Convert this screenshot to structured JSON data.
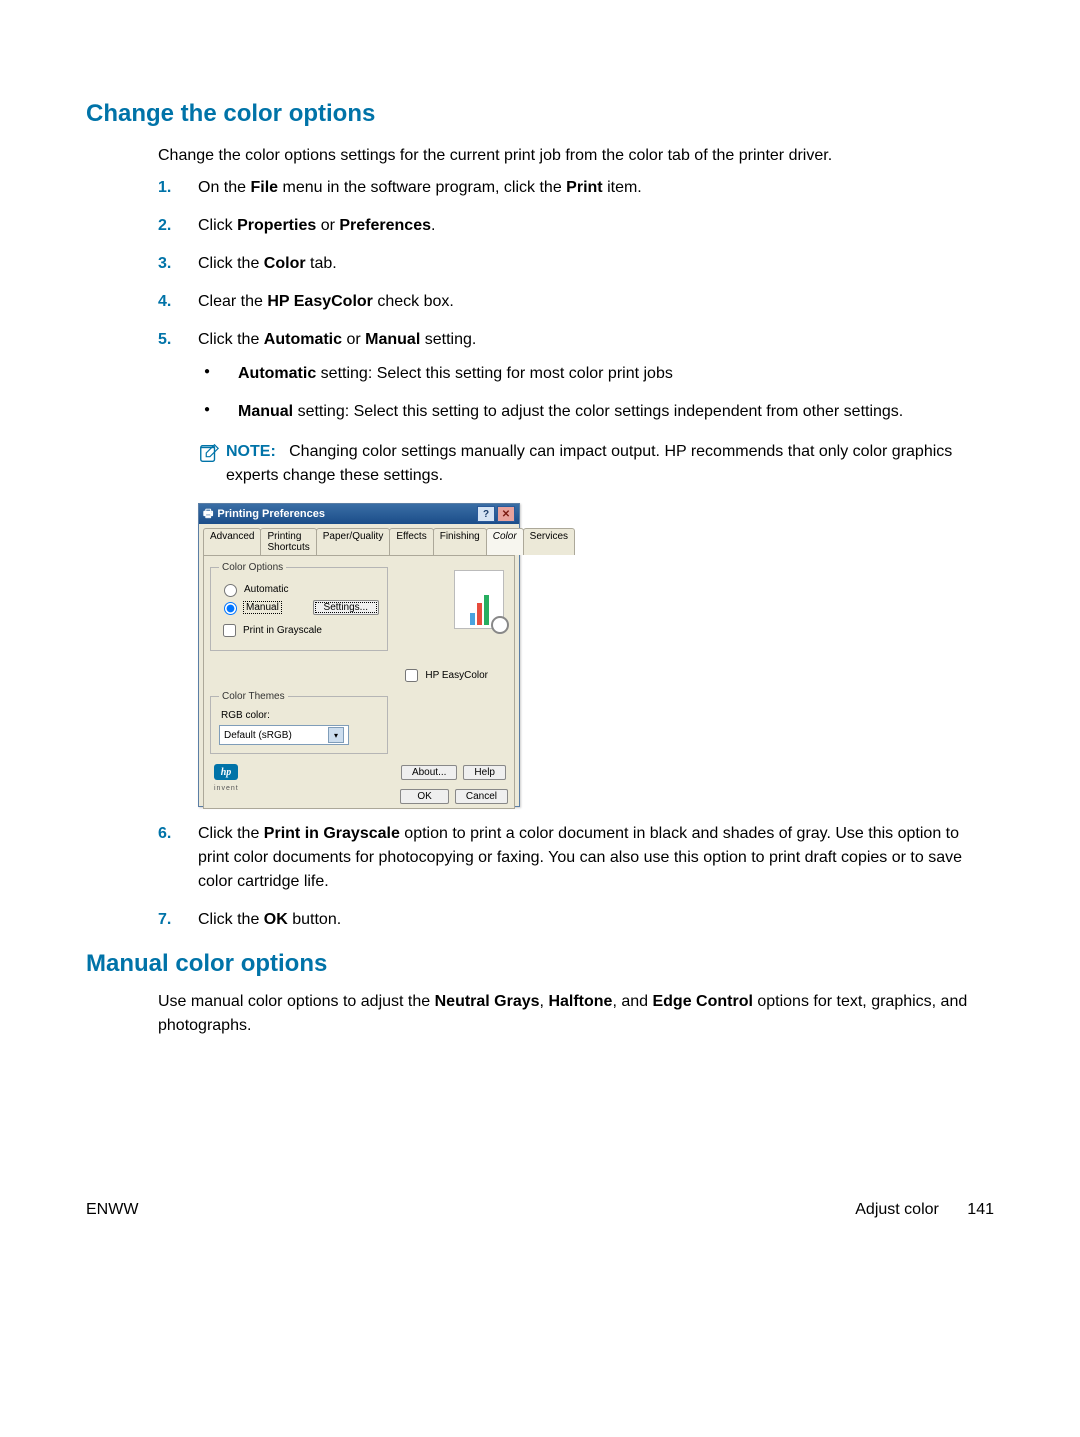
{
  "titles": {
    "change": "Change the color options",
    "manual": "Manual color options"
  },
  "intro": "Change the color options settings for the current print job from the color tab of the printer driver.",
  "manual_intro_pre": "Use manual color options to adjust the ",
  "manual_intro_b1": "Neutral Grays",
  "manual_intro_sep1": ", ",
  "manual_intro_b2": "Halftone",
  "manual_intro_sep2": ", and ",
  "manual_intro_b3": "Edge Control",
  "manual_intro_post": " options for text, graphics, and photographs.",
  "steps": {
    "n1": "1.",
    "n2": "2.",
    "n3": "3.",
    "n4": "4.",
    "n5": "5.",
    "n6": "6.",
    "n7": "7.",
    "s1_pre": "On the ",
    "s1_b1": "File",
    "s1_mid": " menu in the software program, click the ",
    "s1_b2": "Print",
    "s1_post": " item.",
    "s2_pre": "Click ",
    "s2_b1": "Properties",
    "s2_mid": " or ",
    "s2_b2": "Preferences",
    "s2_post": ".",
    "s3_pre": "Click the ",
    "s3_b1": "Color",
    "s3_post": " tab.",
    "s4_pre": "Clear the ",
    "s4_b1": "HP EasyColor",
    "s4_post": " check box.",
    "s5_pre": "Click the ",
    "s5_b1": "Automatic",
    "s5_mid": " or ",
    "s5_b2": "Manual",
    "s5_post": " setting.",
    "s5a_b": "Automatic",
    "s5a": " setting: Select this setting for most color print jobs",
    "s5b_b": "Manual",
    "s5b": " setting: Select this setting to adjust the color settings independent from other settings.",
    "note_label": "NOTE:",
    "note_text": "Changing color settings manually can impact output. HP recommends that only color graphics experts change these settings.",
    "s6_pre": "Click the ",
    "s6_b1": "Print in Grayscale",
    "s6_post": " option to print a color document in black and shades of gray. Use this option to print color documents for photocopying or faxing. You can also use this option to print draft copies or to save color cartridge life.",
    "s7_pre": "Click the ",
    "s7_b1": "OK",
    "s7_post": " button."
  },
  "dialog": {
    "title": "Printing Preferences",
    "tabs": [
      "Advanced",
      "Printing Shortcuts",
      "Paper/Quality",
      "Effects",
      "Finishing",
      "Color",
      "Services"
    ],
    "active_tab": "Color",
    "group_color_options": "Color Options",
    "radio_automatic": "Automatic",
    "radio_manual": "Manual",
    "btn_settings": "Settings...",
    "chk_grayscale": "Print in Grayscale",
    "chk_easycolor": "HP EasyColor",
    "group_color_themes": "Color Themes",
    "label_rgb": "RGB color:",
    "combo_value": "Default (sRGB)",
    "hp": "hp",
    "invent": "invent",
    "btn_about": "About...",
    "btn_help": "Help",
    "btn_ok": "OK",
    "btn_cancel": "Cancel"
  },
  "footer": {
    "left": "ENWW",
    "right_label": "Adjust color",
    "page": "141"
  }
}
